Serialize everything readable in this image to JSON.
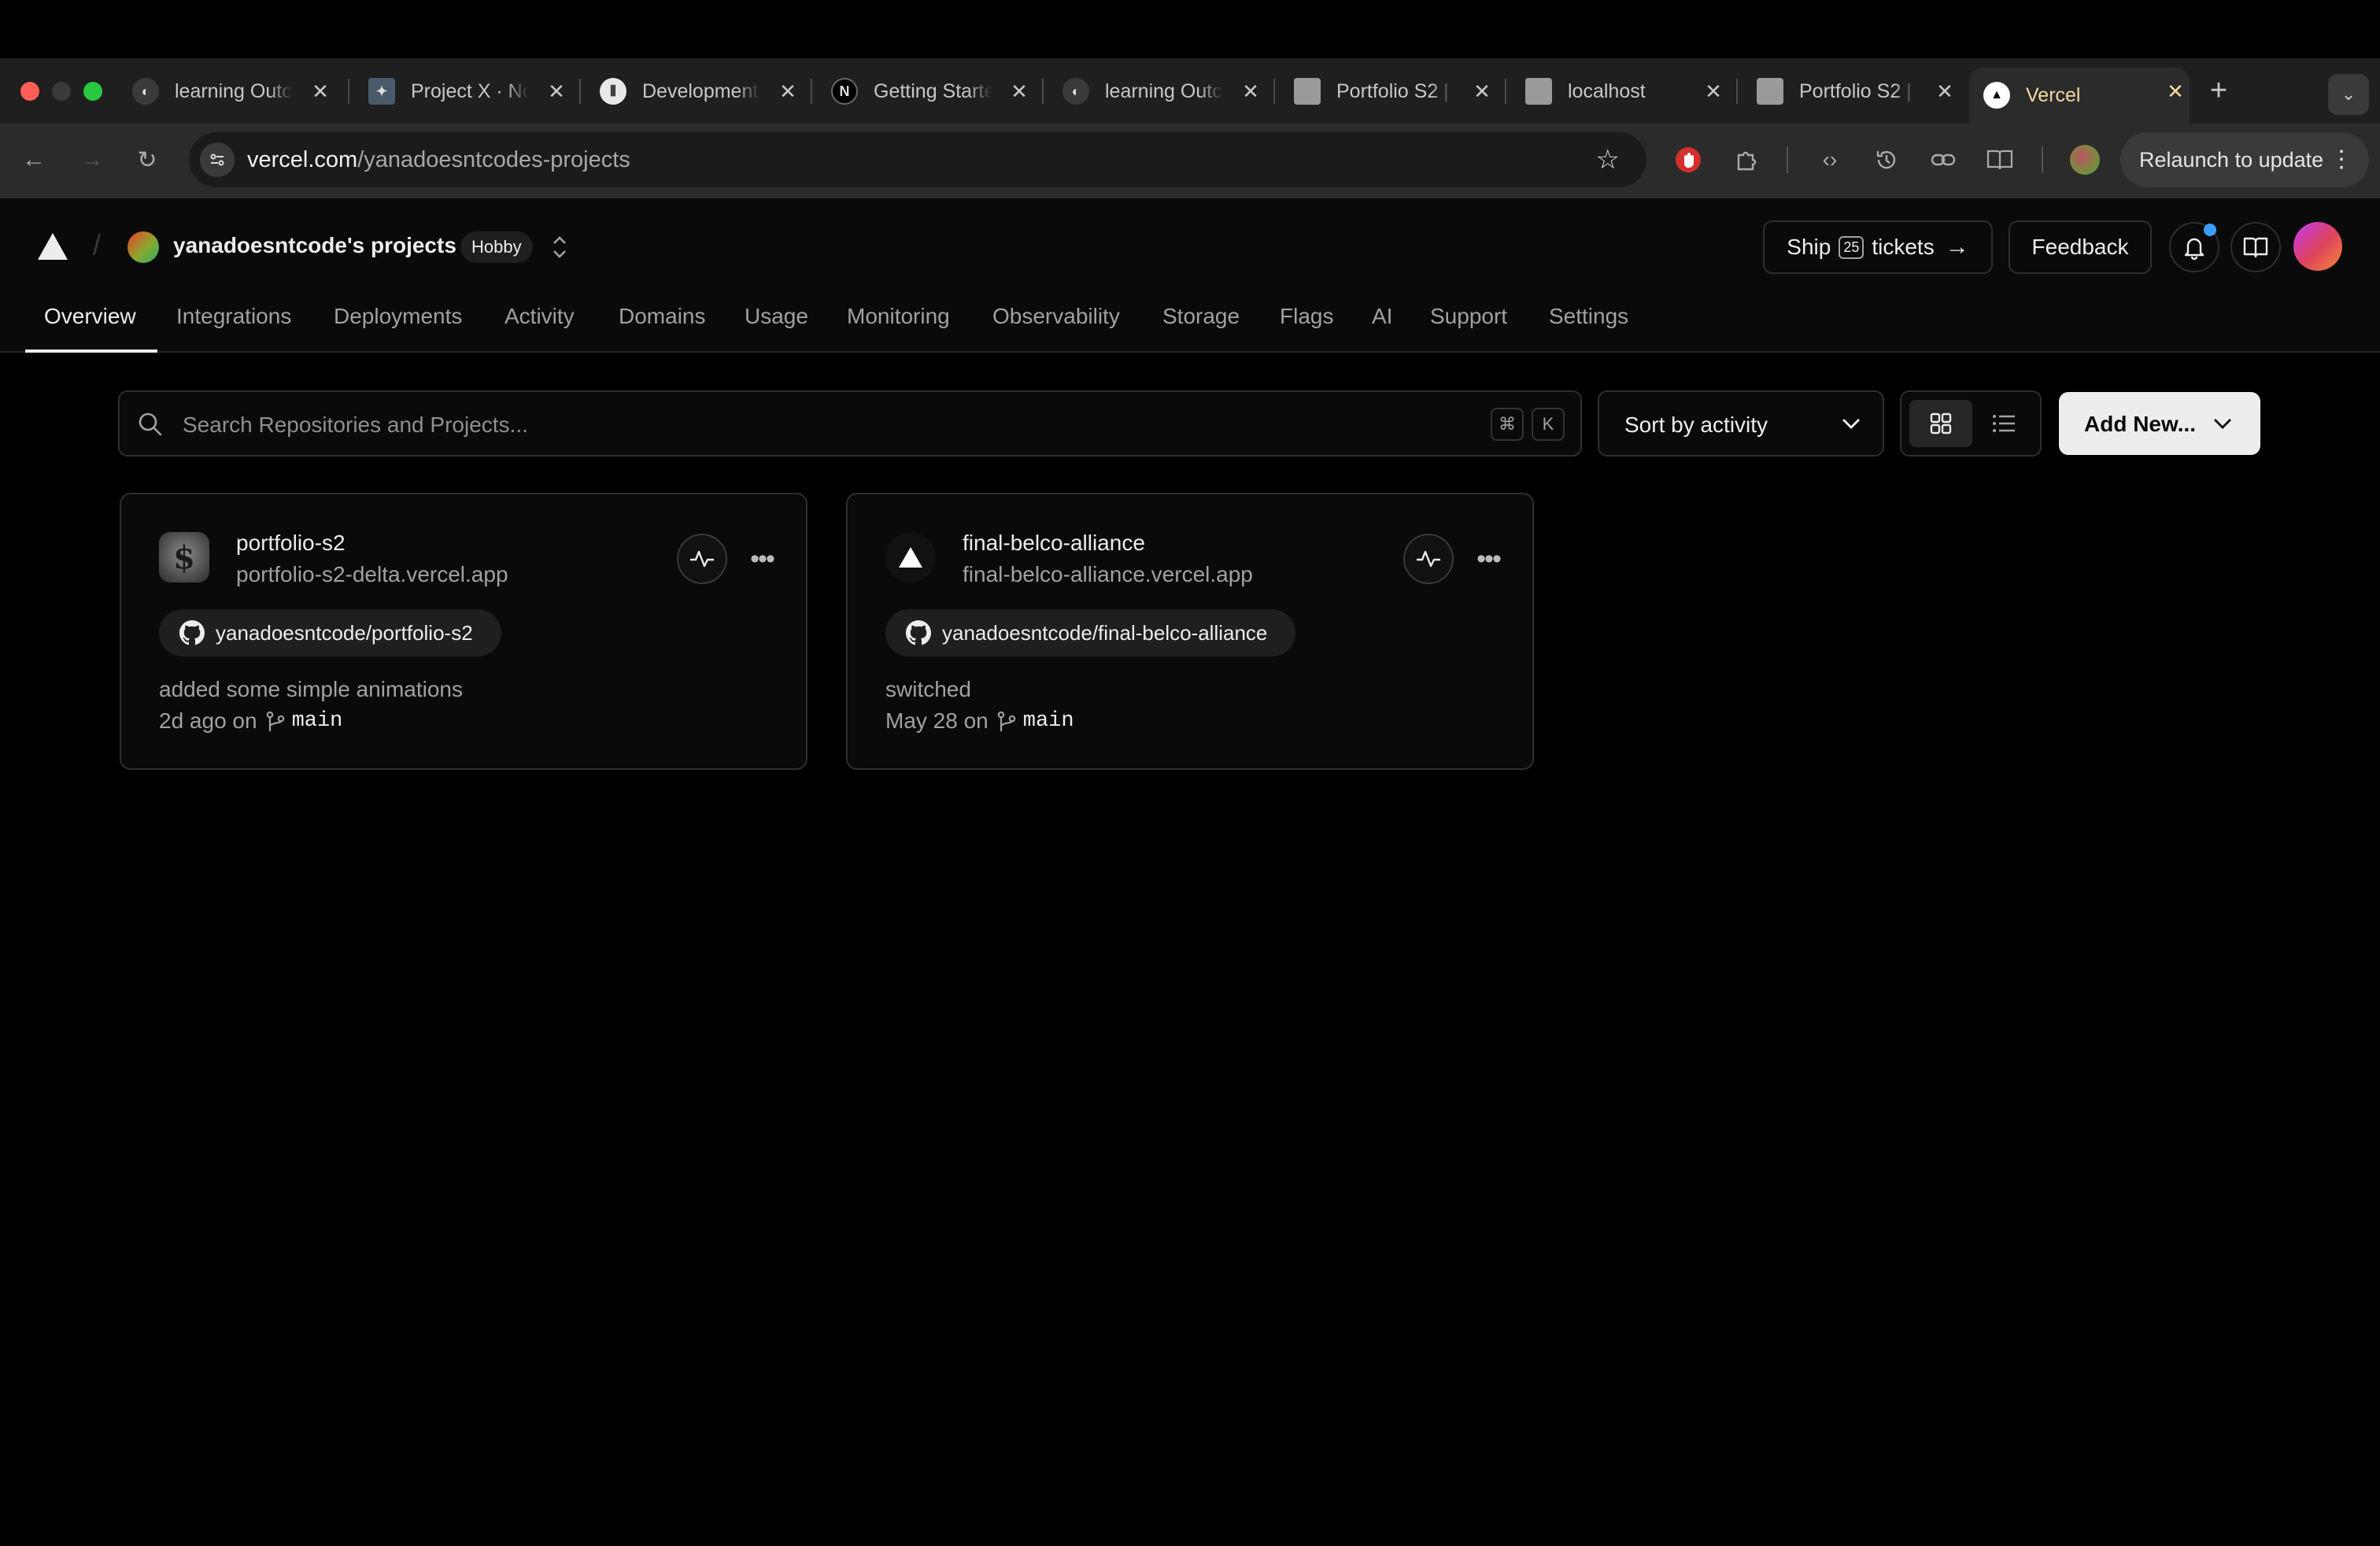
{
  "browser": {
    "tabs": [
      {
        "title": "learning Outc",
        "icon": "globe-icon"
      },
      {
        "title": "Project X · No",
        "icon": "puzzle-icon"
      },
      {
        "title": "Development",
        "icon": "board-icon"
      },
      {
        "title": "Getting Starte",
        "icon": "nextjs-icon"
      },
      {
        "title": "learning Outc",
        "icon": "globe-icon"
      },
      {
        "title": "Portfolio S2 |",
        "icon": "site-icon"
      },
      {
        "title": "localhost",
        "icon": "site-icon"
      },
      {
        "title": "Portfolio S2 |",
        "icon": "site-icon"
      },
      {
        "title": "Vercel",
        "icon": "vercel-icon",
        "active": true
      }
    ],
    "url_host": "vercel.com",
    "url_path": "/yanadoesntcodes-projects",
    "relaunch_label": "Relaunch to update"
  },
  "header": {
    "team_name": "yanadoesntcode's projects",
    "plan_badge": "Hobby",
    "ship_prefix": "Ship",
    "ship_count": "25",
    "ship_suffix": "tickets",
    "feedback_label": "Feedback"
  },
  "nav": {
    "tabs": [
      "Overview",
      "Integrations",
      "Deployments",
      "Activity",
      "Domains",
      "Usage",
      "Monitoring",
      "Observability",
      "Storage",
      "Flags",
      "AI",
      "Support",
      "Settings"
    ],
    "active": "Overview"
  },
  "controls": {
    "search_placeholder": "Search Repositories and Projects...",
    "shortcut_cmd": "⌘",
    "shortcut_key": "K",
    "sort_label": "Sort by activity",
    "view_mode": "grid",
    "add_new_label": "Add New..."
  },
  "projects": [
    {
      "name": "portfolio-s2",
      "url": "portfolio-s2-delta.vercel.app",
      "repo": "yanadoesntcode/portfolio-s2",
      "commit_message": "added some simple animations",
      "time": "2d ago on",
      "branch": "main"
    },
    {
      "name": "final-belco-alliance",
      "url": "final-belco-alliance.vercel.app",
      "repo": "yanadoesntcode/final-belco-alliance",
      "commit_message": "switched",
      "time": "May 28 on",
      "branch": "main"
    }
  ],
  "colors": {
    "background": "#000000",
    "surface": "#0a0a0a",
    "border": "#2e2e2e",
    "text": "#ededed",
    "muted": "#a1a1a1",
    "notification_dot": "#3b9eff"
  }
}
